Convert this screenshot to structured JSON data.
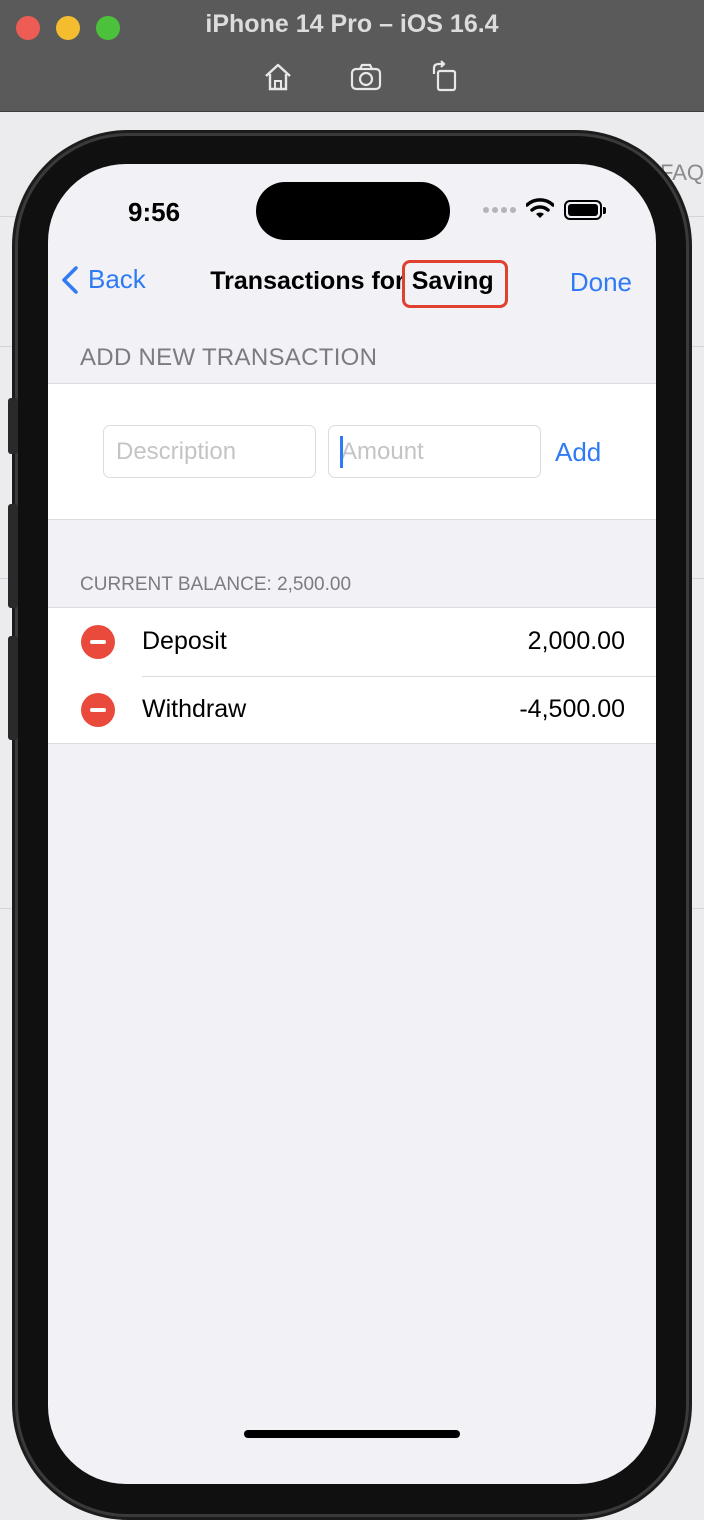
{
  "simulator": {
    "title": "iPhone 14 Pro – iOS 16.4",
    "tools": [
      "home-icon",
      "screenshot-icon",
      "rotate-icon"
    ]
  },
  "background_window": {
    "faq_text": "FAQ"
  },
  "status_bar": {
    "time": "9:56"
  },
  "nav": {
    "back_label": "Back",
    "title_prefix": "Transactions for",
    "title_account": "Saving",
    "done_label": "Done"
  },
  "add_section": {
    "header": "ADD NEW TRANSACTION",
    "description_placeholder": "Description",
    "amount_placeholder": "Amount",
    "add_label": "Add"
  },
  "balance": {
    "header": "CURRENT BALANCE: 2,500.00"
  },
  "transactions": [
    {
      "label": "Deposit",
      "value": "2,000.00"
    },
    {
      "label": "Withdraw",
      "value": "-4,500.00"
    }
  ],
  "colors": {
    "accent": "#2f7bf5",
    "delete": "#ea4a3b",
    "highlight": "#e0402f",
    "grouped_background": "#f1f1f6"
  }
}
